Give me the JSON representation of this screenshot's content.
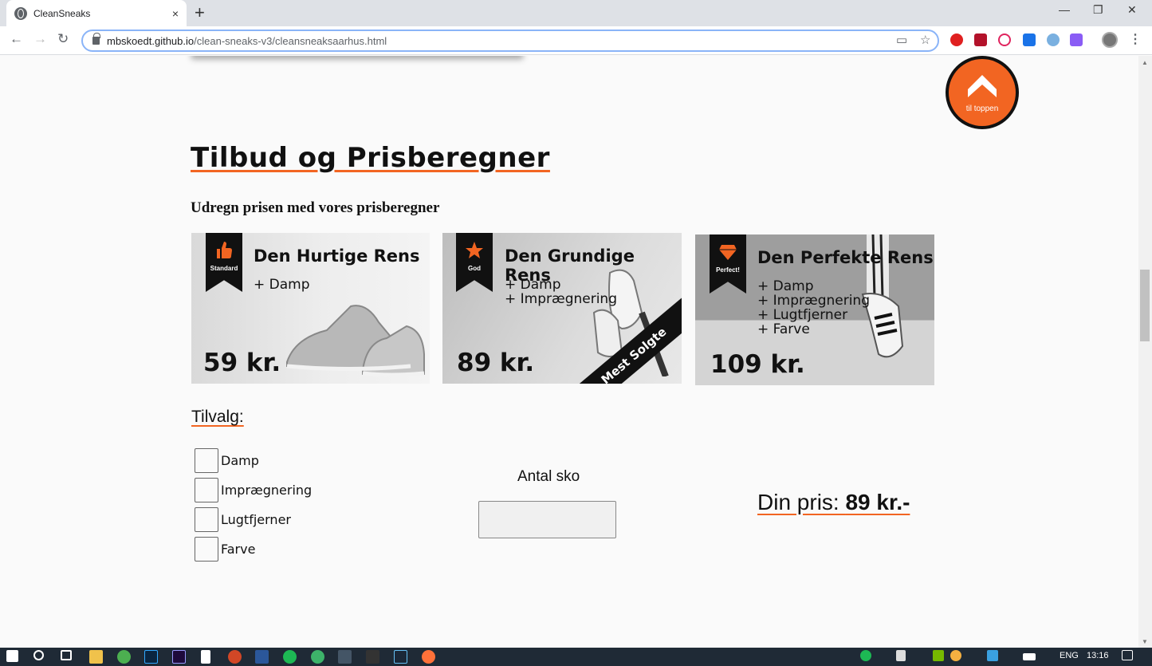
{
  "browser": {
    "tab_title": "CleanSneaks",
    "tab_close": "×",
    "new_tab": "+",
    "url_domain": "mbskoedt.github.io",
    "url_path": "/clean-sneaks-v3/cleansneaksaarhus.html",
    "window_controls": [
      "—",
      "❐",
      "✕"
    ]
  },
  "page": {
    "to_top_label": "til toppen",
    "heading": "Tilbud og Prisberegner",
    "subheading": "Udregn prisen med vores prisberegner",
    "cards": [
      {
        "ribbon": "Standard",
        "title": "Den Hurtige Rens",
        "lines": [
          "+ Damp"
        ],
        "price": "59 kr."
      },
      {
        "ribbon": "God",
        "title": "Den Grundige Rens",
        "lines": [
          "+ Damp",
          "+ Imprægnering"
        ],
        "price": "89 kr.",
        "badge": "Mest Solgte"
      },
      {
        "ribbon": "Perfect!",
        "title": "Den Perfekte Rens",
        "lines": [
          "+ Damp",
          "+ Imprægnering",
          "+ Lugtfjerner",
          "+ Farve"
        ],
        "price": "109 kr."
      }
    ],
    "options_title": "Tilvalg:",
    "options": [
      "Damp",
      "Imprægnering",
      "Lugtfjerner",
      "Farve"
    ],
    "count_label": "Antal sko",
    "count_value": "",
    "price_label": "Din pris: ",
    "price_value": "89 kr.-"
  },
  "taskbar": {
    "lang": "ENG",
    "time": "13:16"
  },
  "colors": {
    "accent": "#f26522"
  }
}
